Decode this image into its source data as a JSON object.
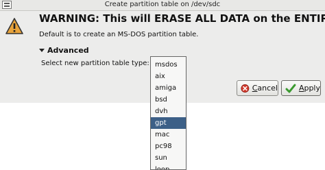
{
  "window": {
    "title": "Create partition table on /dev/sdc"
  },
  "dialog": {
    "heading": "WARNING:  This will ERASE ALL DATA on the ENTIRE DISK /dev/sdc",
    "subtext": "Default is to create an MS-DOS partition table.",
    "expander_label": "Advanced",
    "select_label": "Select new partition table type:",
    "icon": "warning-icon"
  },
  "buttons": {
    "cancel_prefix": "",
    "cancel_mnemonic": "C",
    "cancel_rest": "ancel",
    "apply_prefix": "",
    "apply_mnemonic": "A",
    "apply_rest": "pply"
  },
  "partition_types": {
    "options": [
      "msdos",
      "aix",
      "amiga",
      "bsd",
      "dvh",
      "gpt",
      "mac",
      "pc98",
      "sun",
      "loop"
    ],
    "selected": "gpt"
  },
  "colors": {
    "accent": "#3d6087",
    "warning": "#e8a33b"
  }
}
